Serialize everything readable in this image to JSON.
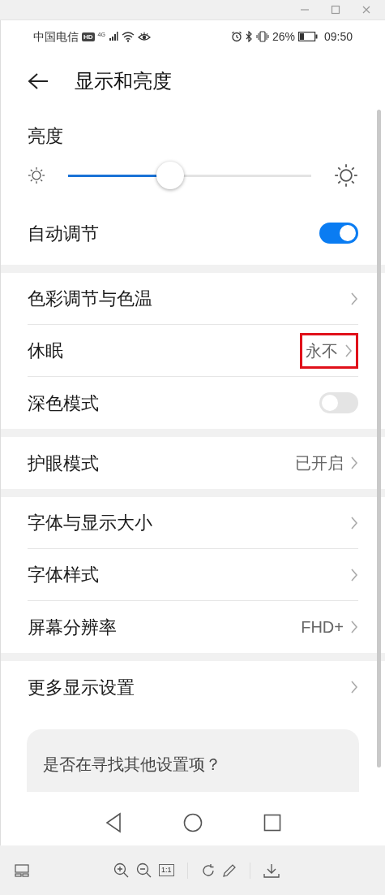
{
  "status_bar": {
    "carrier": "中国电信",
    "hd": "HD",
    "network": "4G",
    "battery": "26%",
    "time": "09:50"
  },
  "header": {
    "title": "显示和亮度"
  },
  "brightness": {
    "label": "亮度",
    "level": 0.42
  },
  "auto_adjust": {
    "label": "自动调节",
    "on": true
  },
  "groups": [
    [
      {
        "kind": "link",
        "label": "色彩调节与色温",
        "highlighted": false
      },
      {
        "kind": "link",
        "label": "休眠",
        "value": "永不",
        "highlighted": true
      },
      {
        "kind": "switch",
        "label": "深色模式",
        "on": false
      }
    ],
    [
      {
        "kind": "link",
        "label": "护眼模式",
        "value": "已开启",
        "highlighted": false
      }
    ],
    [
      {
        "kind": "link",
        "label": "字体与显示大小",
        "highlighted": false
      },
      {
        "kind": "link",
        "label": "字体样式",
        "highlighted": false
      },
      {
        "kind": "link",
        "label": "屏幕分辨率",
        "value": "FHD+",
        "highlighted": false
      }
    ],
    [
      {
        "kind": "link",
        "label": "更多显示设置",
        "highlighted": false
      }
    ]
  ],
  "suggestion": {
    "title": "是否在寻找其他设置项？"
  },
  "viewer_toolbar": {
    "zoom_reset": "1:1"
  }
}
